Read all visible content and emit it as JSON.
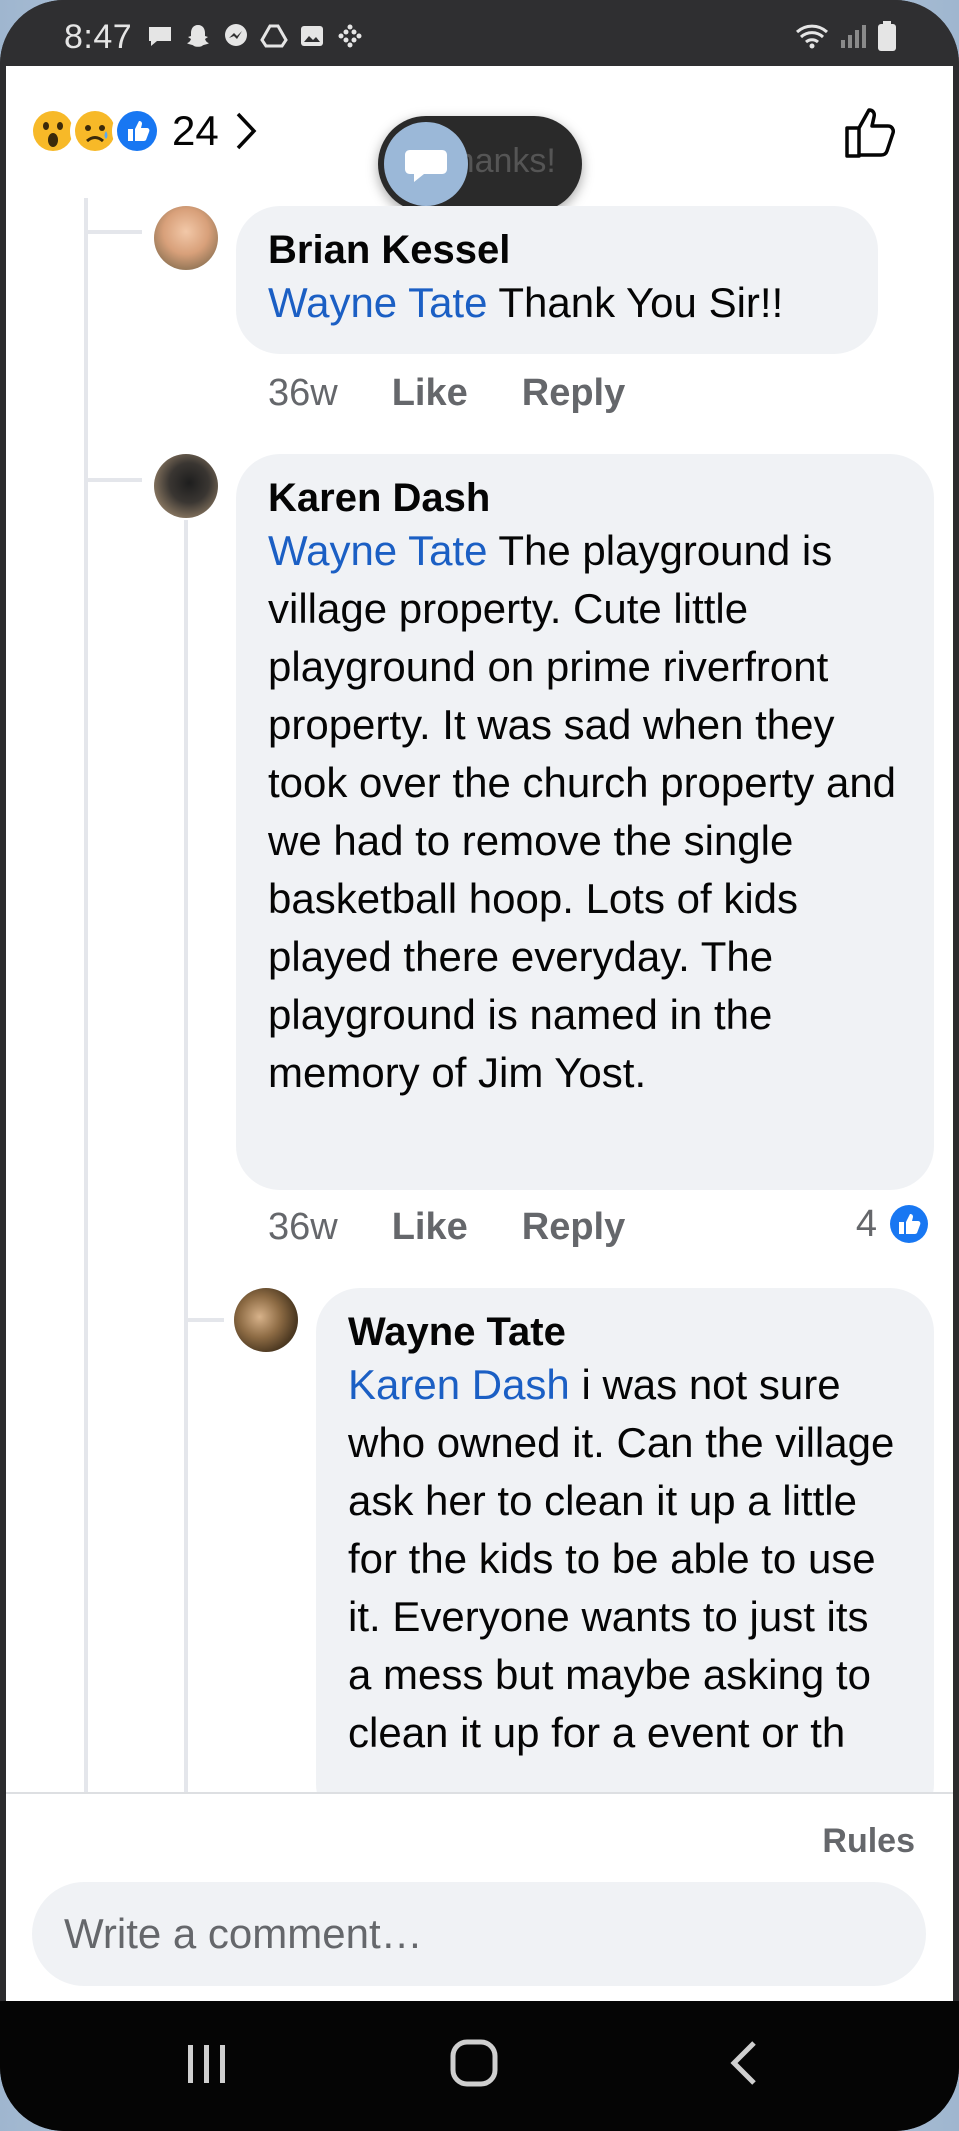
{
  "status_bar": {
    "time": "8:47",
    "icons": [
      "chat-notification-icon",
      "snapchat-icon",
      "messenger-icon",
      "drive-icon",
      "gallery-icon",
      "slack-icon"
    ],
    "right_icons": [
      "wifi-icon",
      "signal-icon",
      "battery-icon"
    ]
  },
  "header": {
    "reaction_count": "24",
    "reactions": [
      "wow-emoji-icon",
      "sad-emoji-icon",
      "like-emoji-icon"
    ],
    "toast_text": "#Thanks!"
  },
  "comments": [
    {
      "author": "Brian Kessel",
      "mention": "Wayne Tate",
      "text": " Thank You Sir!!",
      "time": "36w",
      "like_label": "Like",
      "reply_label": "Reply"
    },
    {
      "author": "Karen Dash",
      "mention": "Wayne Tate",
      "text": " The playground is village property. Cute little playground on prime riverfront property. It was sad when they took over the church property and we had to remove the single basketball hoop. Lots of kids played there everyday. The playground is named in the memory of Jim Yost.",
      "time": "36w",
      "like_label": "Like",
      "reply_label": "Reply",
      "like_count": "4"
    },
    {
      "author": "Wayne Tate",
      "mention": "Karen Dash",
      "text": " i was not sure who owned it. Can the village ask her to clean it up a little for the kids to be able to use it. Everyone wants to just its a mess but maybe asking to clean it up for a event or th"
    }
  ],
  "footer": {
    "rules_label": "Rules",
    "comment_placeholder": "Write a comment…"
  },
  "colors": {
    "mention": "#1b5fc4",
    "bubble": "#f0f2f5",
    "meta": "#65676b",
    "like_blue": "#1877f2"
  }
}
